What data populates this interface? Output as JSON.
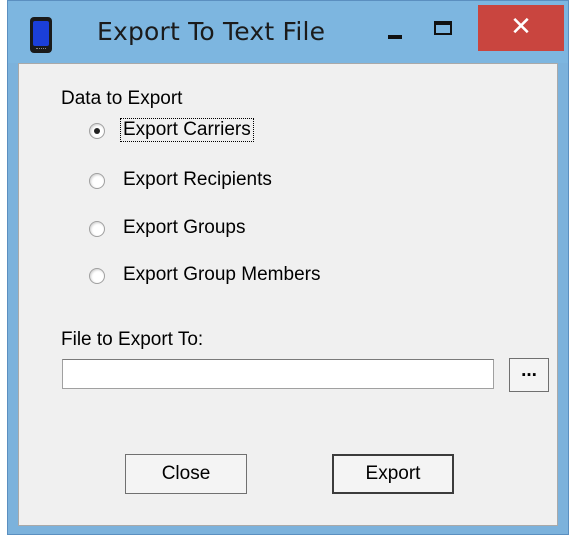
{
  "window": {
    "title": "Export To Text File",
    "close_glyph": "✕"
  },
  "group": {
    "label": "Data to Export"
  },
  "options": [
    {
      "label": "Export Carriers",
      "checked": true
    },
    {
      "label": "Export Recipients",
      "checked": false
    },
    {
      "label": "Export Groups",
      "checked": false
    },
    {
      "label": "Export Group Members",
      "checked": false
    }
  ],
  "file": {
    "label": "File to Export To:",
    "value": "",
    "browse_label": "..."
  },
  "buttons": {
    "close_label": "Close",
    "export_label": "Export"
  },
  "colors": {
    "titlebar": "#7db6e0",
    "close_button": "#c9453f",
    "dialog_bg": "#f0f0f0"
  }
}
